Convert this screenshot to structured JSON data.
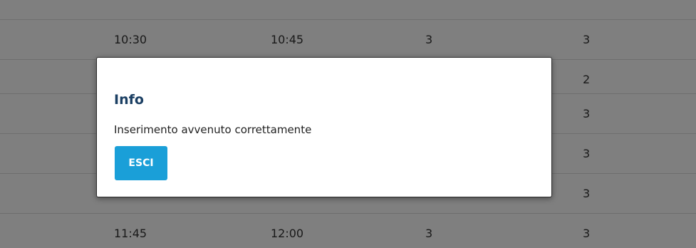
{
  "table": {
    "rows": [
      {
        "start": "10:30",
        "end": "10:45",
        "col3": "3",
        "col4": "3"
      },
      {
        "start": "",
        "end": "",
        "col3": "",
        "col4": "2"
      },
      {
        "start": "",
        "end": "",
        "col3": "",
        "col4": "3"
      },
      {
        "start": "",
        "end": "",
        "col3": "",
        "col4": "3"
      },
      {
        "start": "",
        "end": "",
        "col3": "",
        "col4": "3"
      },
      {
        "start": "11:45",
        "end": "12:00",
        "col3": "3",
        "col4": "3"
      }
    ]
  },
  "dialog": {
    "title": "Info",
    "message": "Inserimento avvenuto correttamente",
    "button_label": "ESCI",
    "button_color": "#1a9fd8",
    "title_color": "#1b3f63"
  }
}
